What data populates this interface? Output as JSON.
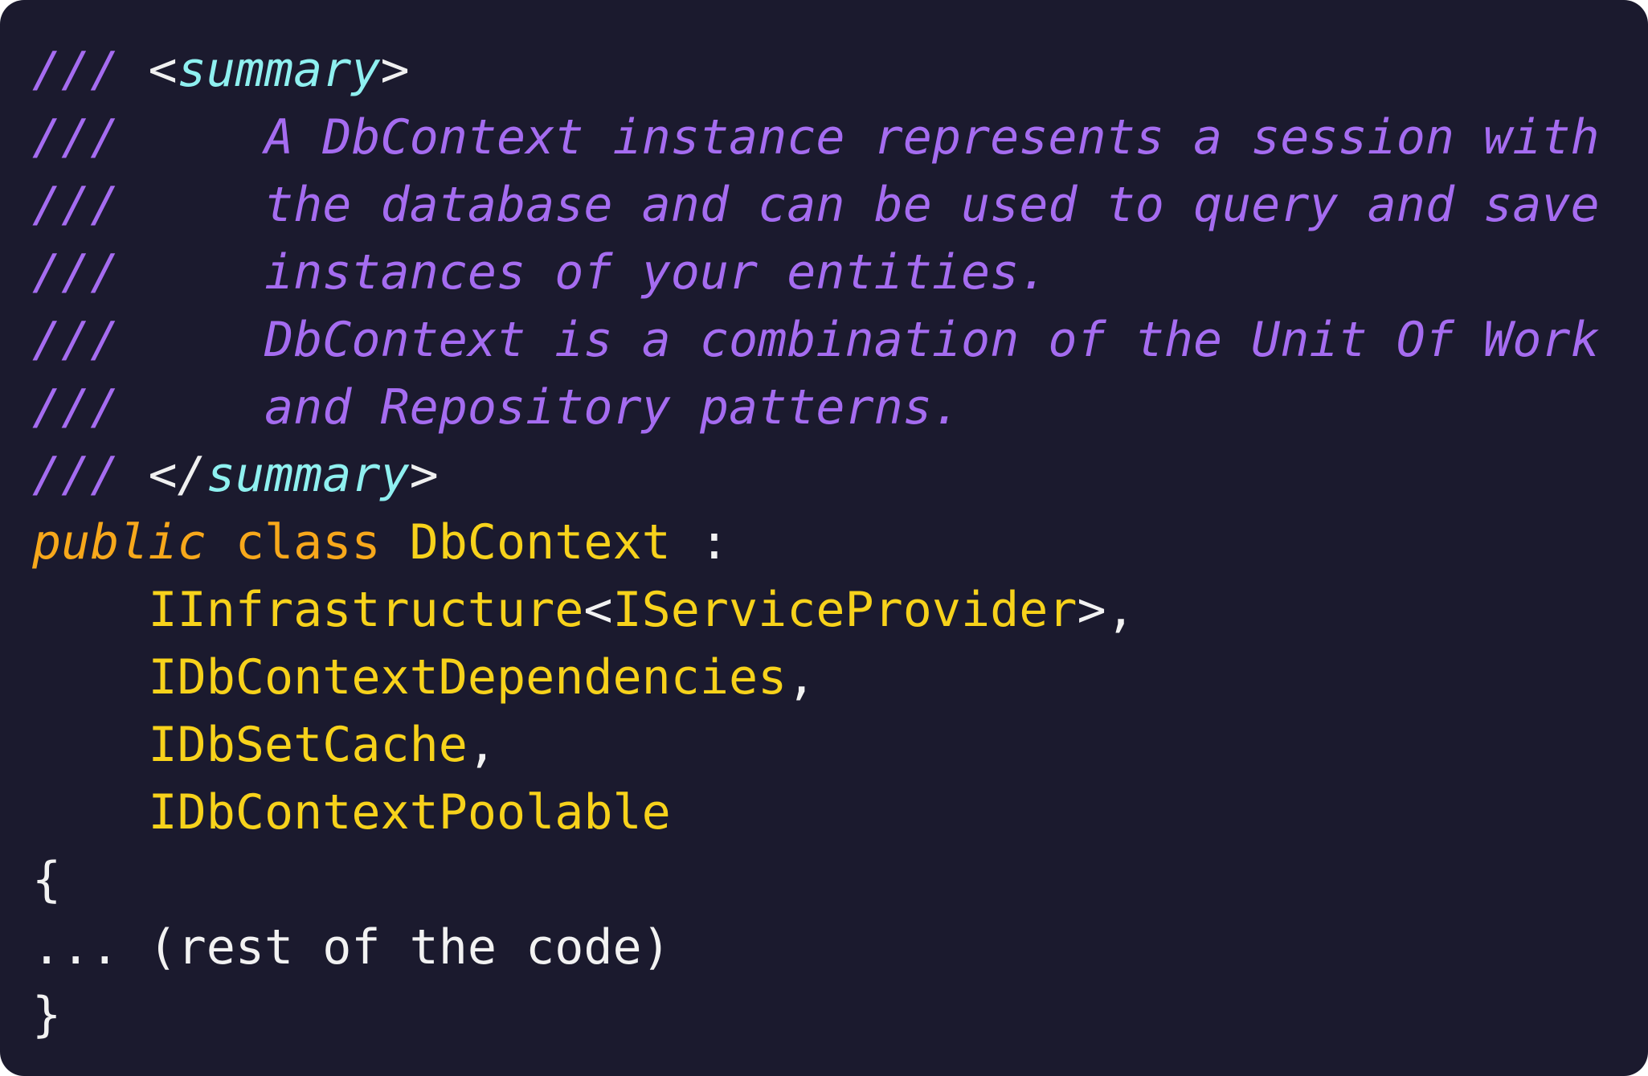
{
  "code": {
    "comment_prefix": "///",
    "summary_open": {
      "lt": "<",
      "name": "summary",
      "gt": ">"
    },
    "summary_close": {
      "lt": "</",
      "name": "summary",
      "gt": ">"
    },
    "doc_lines": [
      "A DbContext instance represents a session with",
      "the database and can be used to query and save",
      "instances of your entities.",
      "DbContext is a combination of the Unit Of Work",
      "and Repository patterns."
    ],
    "modifier": "public",
    "keyword": "class",
    "class_name": "DbContext",
    "colon": ":",
    "interfaces": {
      "i1_name": "IInfrastructure",
      "i1_lt": "<",
      "i1_arg": "IServiceProvider",
      "i1_gt": ">",
      "i1_sep": ",",
      "i2_name": "IDbContextDependencies",
      "i2_sep": ",",
      "i3_name": "IDbSetCache",
      "i3_sep": ",",
      "i4_name": "IDbContextPoolable"
    },
    "open_brace": "{",
    "body_placeholder": "... (rest of the code)",
    "close_brace": "}"
  },
  "colors": {
    "background": "#1b1a2e",
    "comment": "#a56cf0",
    "tag_name": "#8ff0f0",
    "keyword": "#f7a81b",
    "type": "#f7d21b",
    "text": "#f2f2f2"
  }
}
